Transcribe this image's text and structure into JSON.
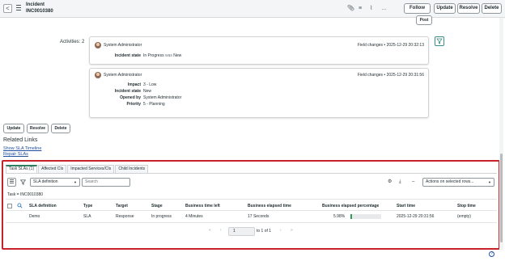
{
  "header": {
    "back_glyph": "<",
    "record_type": "Incident",
    "record_number": "INC0010380",
    "icons": [
      "paperclip-icon",
      "sliders-icon",
      "pulse-icon",
      "more-icon"
    ],
    "buttons": {
      "follow": "Follow",
      "update": "Update",
      "resolve": "Resolve",
      "delete": "Delete"
    }
  },
  "activity": {
    "post_label": "Post",
    "activities_label": "Activities: 2",
    "entries": [
      {
        "user": "System Administrator",
        "type": "Field changes",
        "timestamp": "2025-12-29 20:32:13",
        "fields": [
          {
            "label": "Incident state",
            "value": "In Progress",
            "was": "was",
            "old": "New"
          }
        ]
      },
      {
        "user": "System Administrator",
        "type": "Field changes",
        "timestamp": "2025-12-29 20:31:56",
        "fields": [
          {
            "label": "Impact",
            "value": "3 - Low"
          },
          {
            "label": "Incident state",
            "value": "New"
          },
          {
            "label": "Opened by",
            "value": "System Administrator"
          },
          {
            "label": "Priority",
            "value": "5 - Planning"
          }
        ]
      }
    ]
  },
  "actions": {
    "update": "Update",
    "resolve": "Resolve",
    "delete": "Delete"
  },
  "related_links": {
    "title": "Related Links",
    "links": [
      "Show SLA Timeline",
      "Repair SLAs"
    ]
  },
  "related_list": {
    "tabs": [
      "Task SLAs (1)",
      "Affected CIs",
      "Impacted Services/CIs",
      "Child Incidents"
    ],
    "active_tab": 0,
    "filter_field": "SLA definition",
    "search_placeholder": "Search",
    "actions_select": "Actions on selected rows...",
    "breadcrumb": "Task = INC0010380",
    "columns": [
      "SLA definition",
      "Type",
      "Target",
      "Stage",
      "Business time left",
      "Business elapsed time",
      "Business elapsed percentage",
      "Start time",
      "Stop time"
    ],
    "rows": [
      {
        "sla_definition": "Demo",
        "type": "SLA",
        "target": "Response",
        "stage": "In progress",
        "business_time_left": "4 Minutes",
        "business_elapsed_time": "17 Seconds",
        "business_elapsed_percentage": "5.98%",
        "business_elapsed_fraction": 0.0598,
        "start_time": "2025-12-29 20:31:56",
        "stop_time": "(empty)"
      }
    ],
    "pagination": {
      "first": "«",
      "prev": "‹",
      "current": "1",
      "of_text": "to 1 of 1",
      "next": "›",
      "last": "»"
    }
  },
  "colors": {
    "highlight": "#c8222b",
    "progress": "#2e9e5b",
    "link": "#1f4fa0",
    "active_tab": "#2e7d5c"
  }
}
